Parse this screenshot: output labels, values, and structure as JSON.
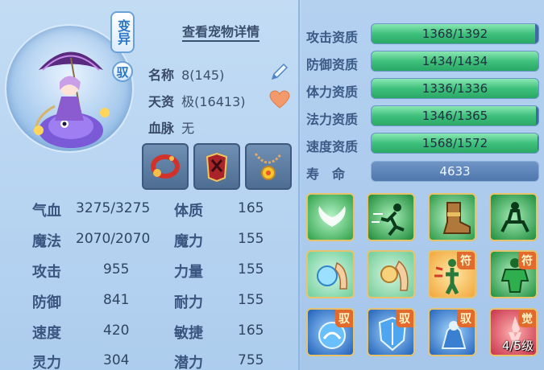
{
  "header": {
    "badge_mutant": "变异",
    "badge_ride": "驭",
    "detail_link": "查看宠物详情"
  },
  "info": {
    "name_label": "名称",
    "name_value": "8(145)",
    "talent_label": "天资",
    "talent_value": "极(16413)",
    "bloodline_label": "血脉",
    "bloodline_value": "无"
  },
  "equipment": [
    {
      "name": "red-bead-collar"
    },
    {
      "name": "red-armor"
    },
    {
      "name": "gold-sun-necklace"
    }
  ],
  "stats": {
    "hp_label": "气血",
    "hp_value": "3275/3275",
    "mp_label": "魔法",
    "mp_value": "2070/2070",
    "atk_label": "攻击",
    "atk_value": "955",
    "def_label": "防御",
    "def_value": "841",
    "spd_label": "速度",
    "spd_value": "420",
    "spi_label": "灵力",
    "spi_value": "304",
    "con_label": "体质",
    "con_value": "165",
    "mag_label": "魔力",
    "mag_value": "155",
    "str_label": "力量",
    "str_value": "155",
    "end_label": "耐力",
    "end_value": "155",
    "agi_label": "敏捷",
    "agi_value": "165",
    "pot_label": "潜力",
    "pot_value": "755"
  },
  "aptitudes": [
    {
      "label": "攻击资质",
      "text": "1368/1392",
      "fill": 0.9828
    },
    {
      "label": "防御资质",
      "text": "1434/1434",
      "fill": 1.0
    },
    {
      "label": "体力资质",
      "text": "1336/1336",
      "fill": 1.0
    },
    {
      "label": "法力资质",
      "text": "1346/1365",
      "fill": 0.9861
    },
    {
      "label": "速度资质",
      "text": "1568/1572",
      "fill": 0.9975
    }
  ],
  "life": {
    "label": "寿　命",
    "value": "4633"
  },
  "skills": [
    {
      "name": "wings-skill"
    },
    {
      "name": "dash-skill"
    },
    {
      "name": "boots-skill"
    },
    {
      "name": "rider-skill"
    },
    {
      "name": "spirit-hand-skill"
    },
    {
      "name": "grip-hand-skill"
    },
    {
      "name": "talisman-figure-skill",
      "tag": "符"
    },
    {
      "name": "muscle-talisman-skill",
      "tag": "符"
    },
    {
      "name": "ride-orb-skill",
      "tag": "驭"
    },
    {
      "name": "ride-shield-skill",
      "tag": "驭"
    },
    {
      "name": "ride-beast-skill",
      "tag": "驭"
    },
    {
      "name": "awaken-skill",
      "tag": "觉",
      "level": "4/5级"
    }
  ],
  "colors": {
    "bar_fill": "#3fc07c",
    "bar_track": "#3f6aa0",
    "label_blue": "#3b5b86"
  }
}
